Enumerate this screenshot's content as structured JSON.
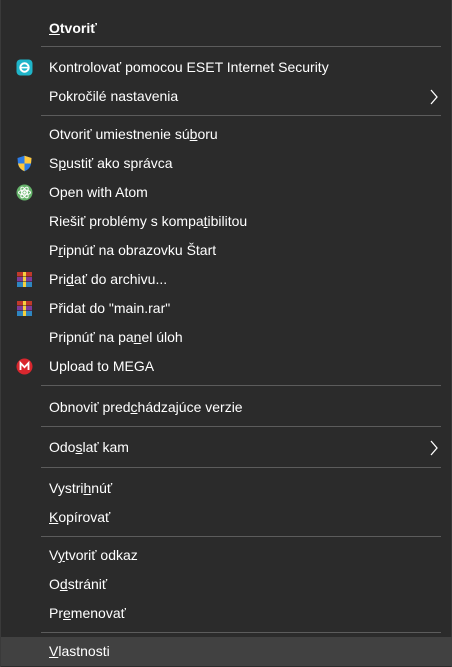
{
  "menu": {
    "items": [
      {
        "pre": "",
        "ul": "O",
        "post": "tvoriť"
      },
      {
        "pre": "Kontrolovať pomocou ESET Internet Security",
        "ul": "",
        "post": ""
      },
      {
        "pre": "Pokročilé nastavenia",
        "ul": "",
        "post": ""
      },
      {
        "pre": "Otvoriť umiestnenie sú",
        "ul": "b",
        "post": "oru"
      },
      {
        "pre": "S",
        "ul": "p",
        "post": "ustiť ako správca"
      },
      {
        "pre": "Open with Atom",
        "ul": "",
        "post": ""
      },
      {
        "pre": "Riešiť problémy s kompa",
        "ul": "t",
        "post": "ibilitou"
      },
      {
        "pre": "P",
        "ul": "r",
        "post": "ipnúť na obrazovku Štart"
      },
      {
        "pre": "Pri",
        "ul": "d",
        "post": "ať do archivu..."
      },
      {
        "pre": "Přidat",
        "ul": "",
        "post": " do \"main.rar\""
      },
      {
        "pre": "Pripnúť na pa",
        "ul": "n",
        "post": "el úloh"
      },
      {
        "pre": "Upload to MEGA",
        "ul": "",
        "post": ""
      },
      {
        "pre": "Obnoviť pred",
        "ul": "c",
        "post": "hádzajúce verzie"
      },
      {
        "pre": "Odo",
        "ul": "s",
        "post": "lať kam"
      },
      {
        "pre": "Vystri",
        "ul": "h",
        "post": "núť"
      },
      {
        "pre": "",
        "ul": "K",
        "post": "opírovať"
      },
      {
        "pre": "V",
        "ul": "y",
        "post": "tvoriť odkaz"
      },
      {
        "pre": "O",
        "ul": "d",
        "post": "strániť"
      },
      {
        "pre": "Pr",
        "ul": "e",
        "post": "menovať"
      },
      {
        "pre": "",
        "ul": "V",
        "post": "lastnosti"
      }
    ],
    "icons": {
      "eset": "eset-icon",
      "uac": "uac-shield-icon",
      "atom": "atom-icon",
      "winrar": "winrar-icon",
      "mega": "mega-icon",
      "submenu": "chevron-right-icon"
    },
    "colors": {
      "background": "#2b2b2b",
      "hover": "#414141",
      "text": "#ffffff",
      "separator": "#5c5c5c",
      "eset_accent": "#1fb5c9",
      "mega_red": "#d9272e",
      "atom_green": "#66b36b"
    }
  }
}
